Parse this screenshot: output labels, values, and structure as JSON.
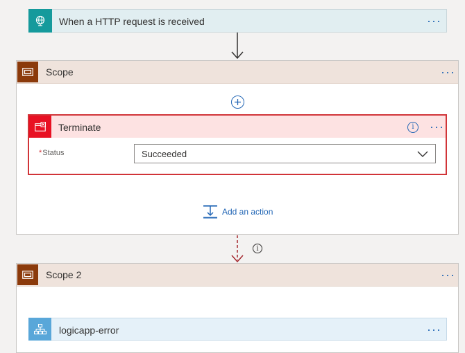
{
  "trigger": {
    "title": "When a HTTP request is received",
    "icon": "globe-icon"
  },
  "scope": {
    "title": "Scope",
    "terminate": {
      "title": "Terminate",
      "status_required_marker": "*",
      "status_label": "Status",
      "status_value": "Succeeded"
    },
    "add_action_label": "Add an action"
  },
  "scope2": {
    "title": "Scope 2",
    "child": {
      "title": "logicapp-error"
    }
  },
  "colors": {
    "trigger_icon_bg": "#159a9c",
    "scope_icon_bg": "#8b3a0b",
    "terminate_icon_bg": "#e81123",
    "terminate_border": "#d13438",
    "link_blue": "#2266b5",
    "run_after_arrow": "#a4262c"
  }
}
